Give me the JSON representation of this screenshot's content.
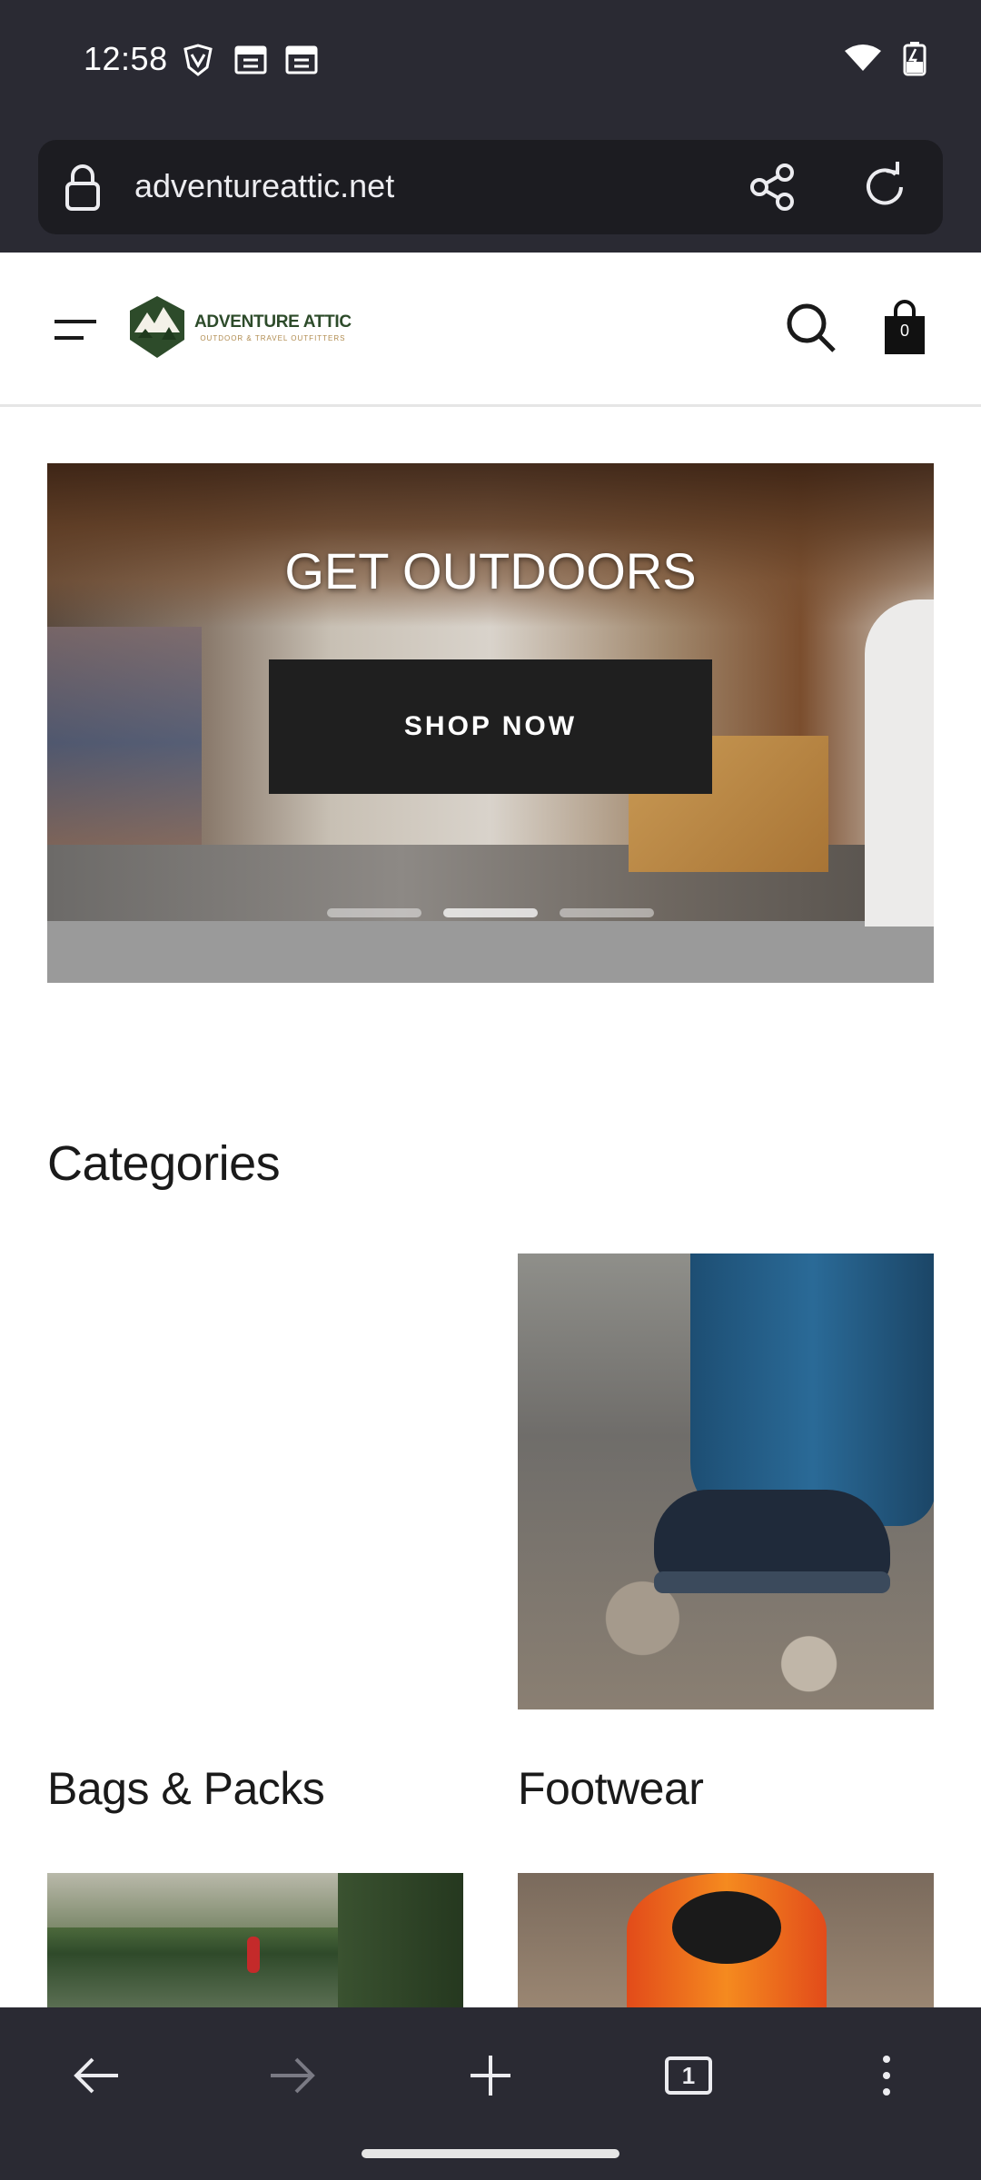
{
  "status_bar": {
    "time": "12:58"
  },
  "browser": {
    "url": "adventureattic.net",
    "tab_count": "1"
  },
  "site": {
    "logo_title": "ADVENTURE ATTIC",
    "logo_subtitle": "OUTDOOR & TRAVEL OUTFITTERS",
    "cart_count": "0"
  },
  "hero": {
    "title": "GET OUTDOORS",
    "button_label": "SHOP NOW",
    "slides": 3,
    "active_slide": 2
  },
  "categories": {
    "title": "Categories",
    "items": [
      {
        "label": "Bags & Packs"
      },
      {
        "label": "Footwear"
      }
    ]
  },
  "colors": {
    "chrome_bg": "#2a2a33",
    "url_box_bg": "#1c1c21",
    "logo_green": "#2d4b2a",
    "button_dark": "#1f1f1f"
  }
}
